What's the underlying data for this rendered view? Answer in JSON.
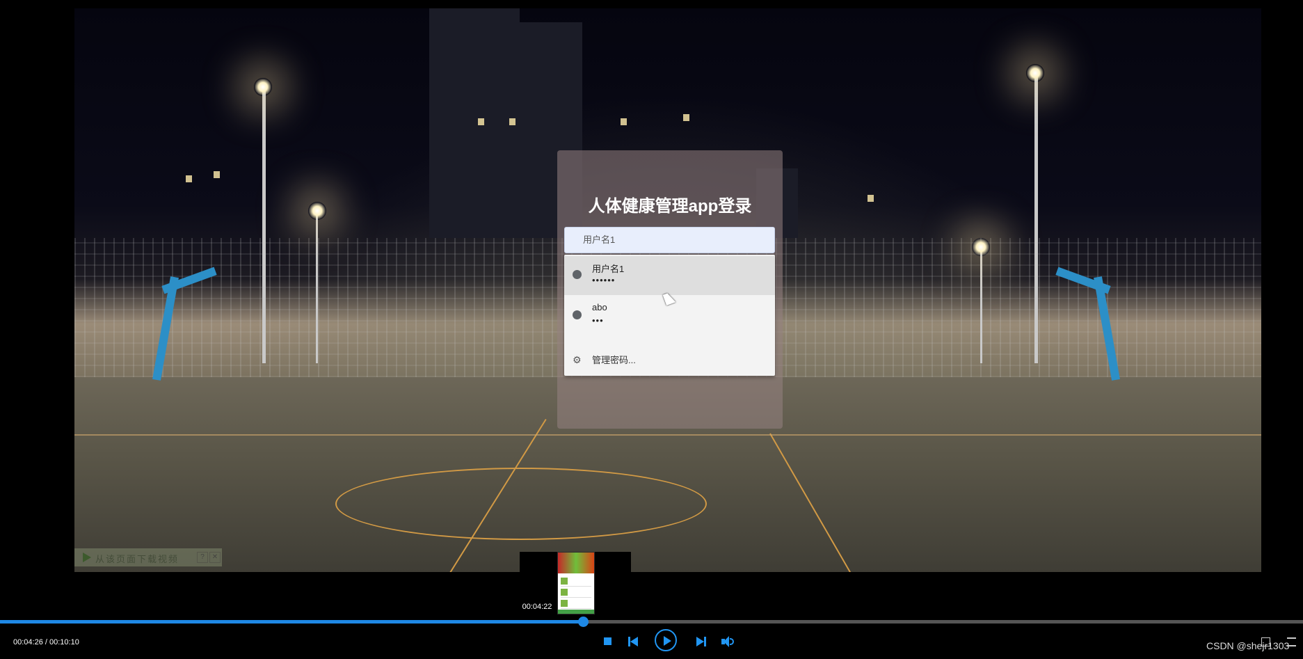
{
  "login": {
    "title": "人体健康管理app登录",
    "username_value": "用户名1"
  },
  "autofill": {
    "options": [
      {
        "name": "用户名1",
        "password": "••••••"
      },
      {
        "name": "abo",
        "password": "•••"
      }
    ],
    "manage_label": "管理密码..."
  },
  "ad_bar": {
    "text": "从该页面下载视频",
    "help": "?",
    "close": "✕"
  },
  "preview": {
    "time": "00:04:22"
  },
  "player": {
    "time_display": "00:04:26 / 00:10:10",
    "progress": 0.4475,
    "accent_color": "#2196f3",
    "controls": [
      "stop-icon",
      "previous-icon",
      "play-icon",
      "next-icon",
      "volume-icon",
      "fullscreen-icon",
      "settings-icon"
    ]
  },
  "watermark": "CSDN @shejr1303"
}
